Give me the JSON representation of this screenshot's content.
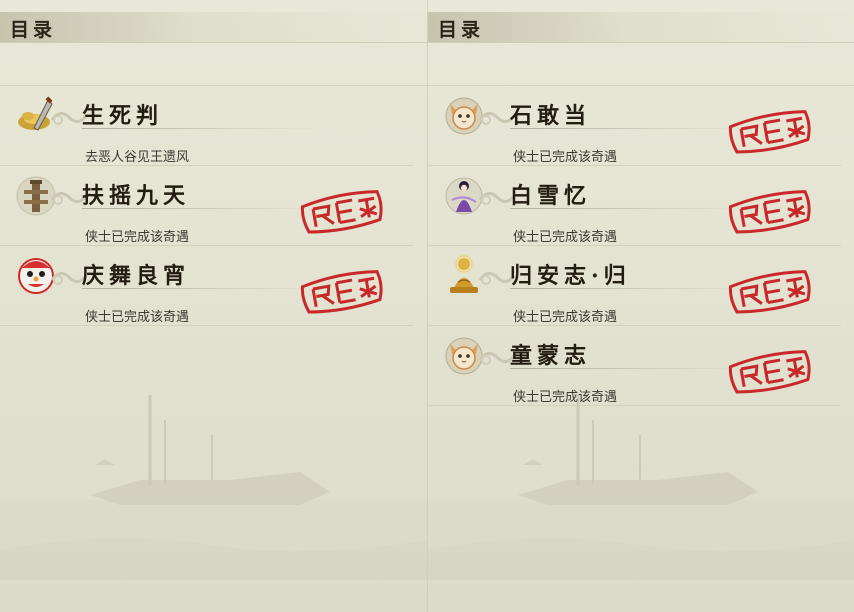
{
  "left_page": {
    "header": "目录",
    "entries": [
      {
        "title": "生死判",
        "status": "去恶人谷见王遗风",
        "icon": "gold-ingot-sword-icon",
        "completed": false
      },
      {
        "title": "扶摇九天",
        "status": "侠士已完成该奇遇",
        "icon": "stake-icon",
        "completed": true
      },
      {
        "title": "庆舞良宵",
        "status": "侠士已完成该奇遇",
        "icon": "lion-dance-icon",
        "completed": true
      }
    ]
  },
  "right_page": {
    "header": "目录",
    "entries": [
      {
        "title": "石敢当",
        "status": "侠士已完成该奇遇",
        "icon": "cat-face-icon",
        "completed": true
      },
      {
        "title": "白雪忆",
        "status": "侠士已完成该奇遇",
        "icon": "purple-lady-icon",
        "completed": true
      },
      {
        "title": "归安志·归",
        "status": "侠士已完成该奇遇",
        "icon": "golden-buddha-icon",
        "completed": true
      },
      {
        "title": "童蒙志",
        "status": "侠士已完成该奇遇",
        "icon": "cat-face-icon",
        "completed": true
      }
    ]
  },
  "colors": {
    "seal_red": "#c8282a",
    "title_ink": "#231c10",
    "paper": "#e6e4d3"
  }
}
